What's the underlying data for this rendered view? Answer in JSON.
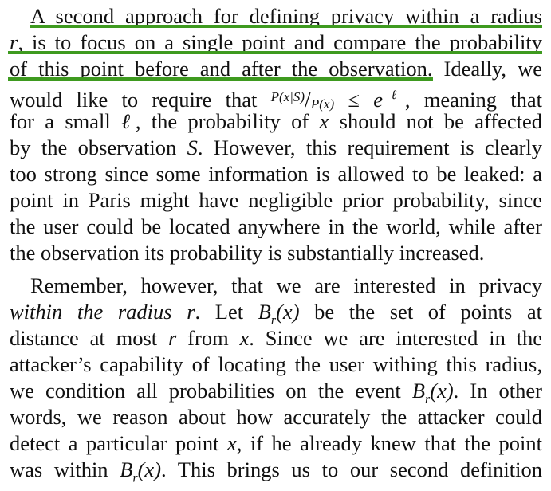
{
  "paragraphs": [
    {
      "lines": [
        "A second approach for defining privacy within a radius",
        "r, is to focus on a single point and compare the probability",
        "of this point before and after the observation. Ideally, we",
        "would like to require that P(x|S)/P(x) ≤ eℓ, meaning that",
        "for a small ℓ, the probability of x should not be affected",
        "by the observation S. However, this requirement is clearly",
        "too strong since some information is allowed to be leaked: a",
        "point in Paris might have negligible prior probability, since",
        "the user could be located anywhere in the world, while after",
        "the observation its probability is substantially increased."
      ]
    },
    {
      "lines": [
        "Remember, however, that we are interested in privacy",
        "within the radius r. Let Br(x) be the set of points at",
        "distance at most r from x. Since we are interested in the",
        "attacker’s capability of locating the user withing this radius,",
        "we condition all probabilities on the event Br(x). In other",
        "words, we reason about how accurately the attacker could",
        "detect a particular point x, if he already knew that the point",
        "was within Br(x). This brings us to our second definition"
      ]
    }
  ],
  "pieces": {
    "l1": "A second approach for defining privacy within a radius",
    "l2_r": "r",
    "l2_rest": ", is to focus on a single point and compare the probability",
    "l3": "of this point before and after the observation. Ideally, we",
    "l4_a": "would like to require that",
    "l4_num": "P(x|S)",
    "l4_slash": "/",
    "l4_den": "P(x)",
    "l4_leq": "≤",
    "l4_e": "e",
    "l4_ell": "ℓ",
    "l4_b": ", meaning that",
    "l5_a": "for a small",
    "l5_ell": "ℓ",
    "l5_b": ", the probability of",
    "l5_x": "x",
    "l5_c": "should not be affected",
    "l6_a": "by the observation",
    "l6_S": "S",
    "l6_b": ". However, this requirement is clearly",
    "l7": "too strong since some information is allowed to be leaked: a",
    "l8": "point in Paris might have negligible prior probability, since",
    "l9": "the user could be located anywhere in the world, while after",
    "l10": "the observation its probability is substantially increased.",
    "p2l1": "Remember, however, that we are interested in privacy",
    "p2l2_it": "within the radius",
    "p2l2_r": "r",
    "p2l2_a": ". Let",
    "p2l2_B": "B",
    "p2l2_sub": "r",
    "p2l2_x": "(x)",
    "p2l2_b": "be the set of points at",
    "p2l3_a": "distance at most",
    "p2l3_r": "r",
    "p2l3_b": "from",
    "p2l3_x": "x",
    "p2l3_c": ". Since we are interested in the",
    "p2l4": "attacker’s capability of locating the user withing this radius,",
    "p2l5_a": "we condition all probabilities on the event",
    "p2l5_B": "B",
    "p2l5_sub": "r",
    "p2l5_x": "(x)",
    "p2l5_b": ". In other",
    "p2l6": "words, we reason about how accurately the attacker could",
    "p2l7_a": "detect a particular point",
    "p2l7_x": "x",
    "p2l7_b": ", if he already knew that the point",
    "p2l8_a": "was within",
    "p2l8_B": "B",
    "p2l8_sub": "r",
    "p2l8_x": "(x)",
    "p2l8_b": ". This brings us to our second definition"
  },
  "highlight": {
    "color": "#3e9a1f",
    "text": "A second approach for defining privacy within a radius r, is to focus on a single point and compare the probability of this point before and after the observation."
  }
}
